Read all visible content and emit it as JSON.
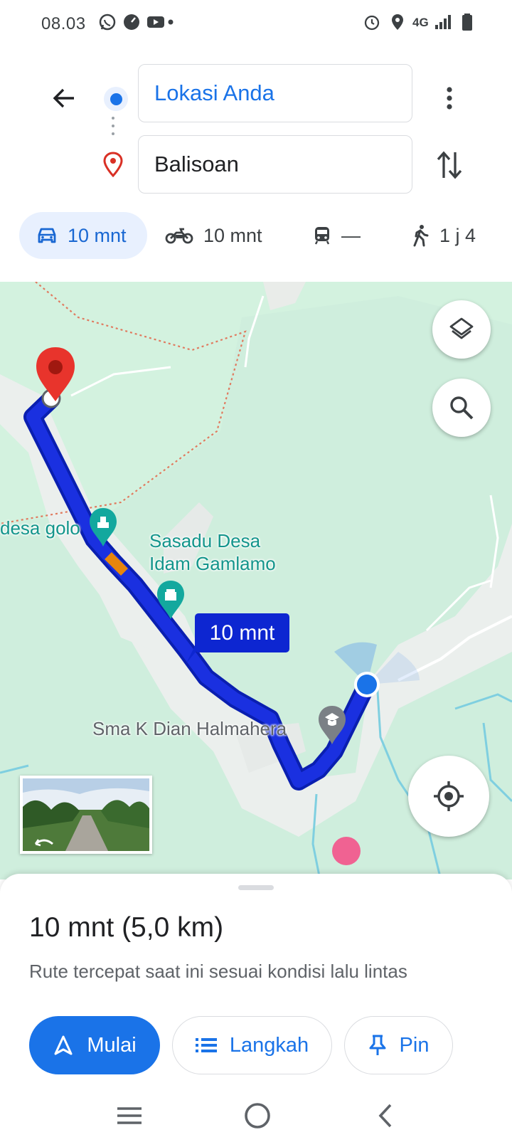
{
  "status_bar": {
    "time": "08.03",
    "network": "4G",
    "left_icons": [
      "whatsapp-icon",
      "speedometer-icon",
      "youtube-icon"
    ],
    "right_icons": [
      "alarm-icon",
      "location-icon",
      "signal-icon",
      "battery-icon"
    ]
  },
  "directions": {
    "origin": "Lokasi Anda",
    "destination": "Balisoan",
    "modes": [
      {
        "icon": "car-icon",
        "label": "10 mnt",
        "selected": true
      },
      {
        "icon": "motorcycle-icon",
        "label": "10 mnt",
        "selected": false
      },
      {
        "icon": "train-icon",
        "label": "—",
        "selected": false
      },
      {
        "icon": "walk-icon",
        "label": "1 j 4",
        "selected": false
      }
    ]
  },
  "map": {
    "labels": {
      "place_left": "desa golo",
      "poi_1_line1": "Sasadu Desa",
      "poi_1_line2": "Idam Gamlamo",
      "school": "Sma K Dian Halmahera"
    },
    "route_time": "10 mnt",
    "colors": {
      "route": "#1a30e0",
      "map_green": "#cfeedd",
      "traffic": "#e8850c"
    }
  },
  "summary": {
    "title": "10 mnt (5,0 km)",
    "description": "Rute tercepat saat ini sesuai kondisi lalu lintas"
  },
  "actions": {
    "start": "Mulai",
    "steps": "Langkah",
    "pin": "Pin"
  },
  "colors": {
    "accent": "#1a73e8",
    "selected_chip": "#e8f0fe"
  }
}
